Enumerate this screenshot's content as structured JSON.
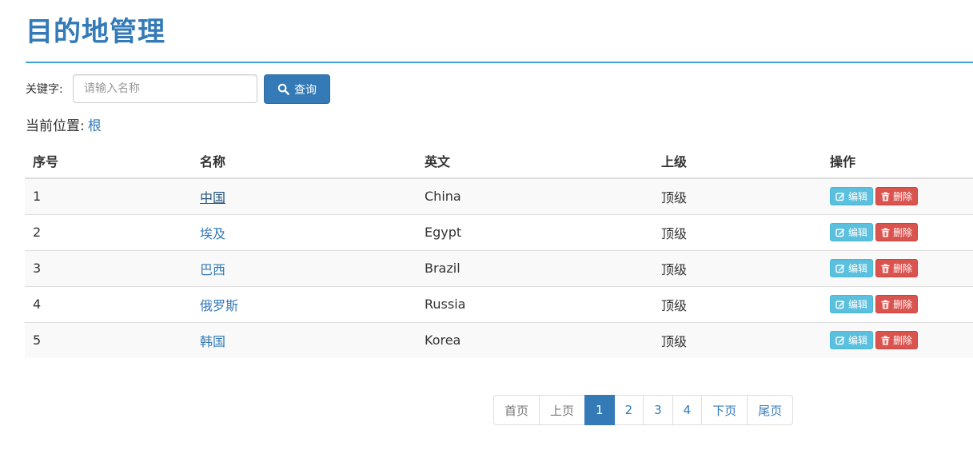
{
  "page": {
    "title": "目的地管理"
  },
  "search": {
    "label": "关键字:",
    "placeholder": "请输入名称",
    "value": "",
    "button_label": "查询"
  },
  "location": {
    "label": "当前位置:",
    "current": "根"
  },
  "table": {
    "headers": [
      "序号",
      "名称",
      "英文",
      "上级",
      "操作"
    ],
    "rows": [
      {
        "index": "1",
        "name": "中国",
        "english": "China",
        "parent": "顶级"
      },
      {
        "index": "2",
        "name": "埃及",
        "english": "Egypt",
        "parent": "顶级"
      },
      {
        "index": "3",
        "name": "巴西",
        "english": "Brazil",
        "parent": "顶级"
      },
      {
        "index": "4",
        "name": "俄罗斯",
        "english": "Russia",
        "parent": "顶级"
      },
      {
        "index": "5",
        "name": "韩国",
        "english": "Korea",
        "parent": "顶级"
      }
    ],
    "edit_label": "编辑",
    "delete_label": "删除"
  },
  "pagination": {
    "first": "首页",
    "prev": "上页",
    "pages": [
      "1",
      "2",
      "3",
      "4"
    ],
    "current": "1",
    "next": "下页",
    "last": "尾页"
  },
  "colors": {
    "primary": "#337ab7",
    "info": "#5bc0de",
    "danger": "#d9534f",
    "rule": "#3fa7d6"
  }
}
